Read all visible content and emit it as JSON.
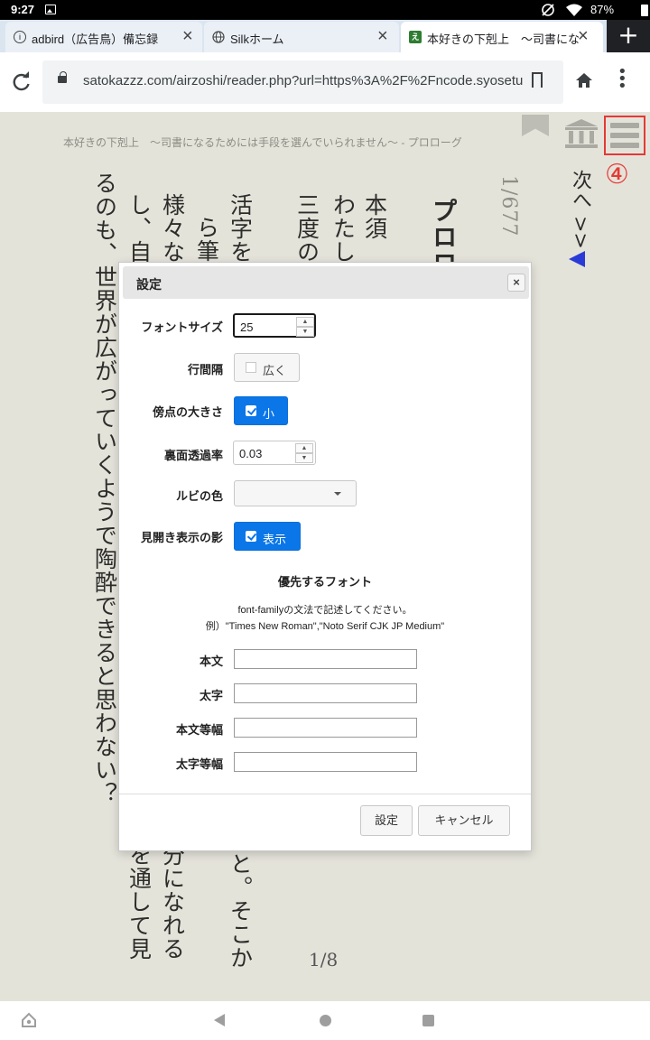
{
  "status_bar": {
    "time": "9:27",
    "battery": "87%"
  },
  "tabs": [
    {
      "title": "adbird（広告鳥）備忘録",
      "favicon": "info-icon",
      "close": "×"
    },
    {
      "title": "Silkホーム",
      "favicon": "globe-icon",
      "close": "×"
    },
    {
      "title": "本好きの下剋上　〜司書にな",
      "favicon": "え",
      "close": "×"
    }
  ],
  "new_tab": "+",
  "address_bar": {
    "url": "satokazzz.com/airzoshi/reader.php?url=https%3A%2F%2Fncode.syosetu.com"
  },
  "reader": {
    "header": "本好きの下剋上　〜司書になるためには手段を選んでいられません〜 - プロローグ",
    "annotation": "④",
    "next_link": "次へ >>",
    "page_count": "1/677",
    "columns": [
      {
        "text": "プロロ",
        "tone": "dark"
      },
      {
        "text": "本須",
        "tone": "dark"
      },
      {
        "text": "わたしは",
        "tone": "dark"
      },
      {
        "text": "三度のご",
        "tone": "dark"
      },
      {
        "text": "活字を追",
        "tone": "dark"
      },
      {
        "text": "ら筆者の思",
        "tone": "dark"
      },
      {
        "text": "様々な知",
        "tone": "dark"
      },
      {
        "text": "し、自分が",
        "tone": "dark"
      },
      {
        "text": "るのも、世界が広がっていくようで陶酔できると思わない？",
        "tone": "dark"
      }
    ],
    "lower_fragments": [
      {
        "text": "と。そこか"
      },
      {
        "text": "分になれる"
      },
      {
        "text": "を通して見"
      }
    ],
    "page_no": "1/8"
  },
  "dialog": {
    "title": "設定",
    "close": "×",
    "font_size": {
      "label": "フォントサイズ",
      "value": "25"
    },
    "line_spacing": {
      "label": "行間隔",
      "option": "広く",
      "checked": false
    },
    "emphasis_size": {
      "label": "傍点の大きさ",
      "option": "小",
      "checked": true
    },
    "back_opacity": {
      "label": "裏面透過率",
      "value": "0.03"
    },
    "ruby_color": {
      "label": "ルビの色",
      "value": ""
    },
    "spread_shadow": {
      "label": "見開き表示の影",
      "option": "表示",
      "checked": true
    },
    "font_section": {
      "title": "優先するフォント",
      "note_line1": "font-familyの文法で記述してください。",
      "note_line2": "例）\"Times New Roman\",\"Noto Serif CJK JP Medium\"",
      "fields": [
        {
          "label": "本文",
          "value": ""
        },
        {
          "label": "太字",
          "value": ""
        },
        {
          "label": "本文等幅",
          "value": ""
        },
        {
          "label": "太字等幅",
          "value": ""
        }
      ]
    },
    "ok_button": "設定",
    "cancel_button": "キャンセル"
  }
}
